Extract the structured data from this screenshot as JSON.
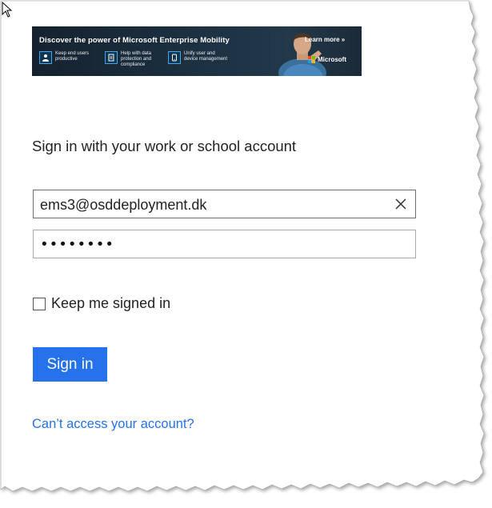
{
  "banner": {
    "title": "Discover the power of Microsoft Enterprise Mobility",
    "features": [
      {
        "icon": "user-icon",
        "text": "Keep end users\nproductive"
      },
      {
        "icon": "document-icon",
        "text": "Help with data\nprotection and\ncompliance"
      },
      {
        "icon": "device-icon",
        "text": "Unify user and\ndevice management"
      }
    ],
    "learn_more": "Learn more »",
    "brand": "Microsoft",
    "brand_colors": [
      "#f25022",
      "#7fba00",
      "#00a4ef",
      "#ffb900"
    ]
  },
  "heading": "Sign in with your work or school account",
  "email": {
    "value": "ems3@osddeployment.dk",
    "clear_icon": "close-icon"
  },
  "password": {
    "masked_value": "••••••••"
  },
  "keep_signed_in": {
    "label": "Keep me signed in",
    "checked": false
  },
  "signin_button": {
    "label": "Sign in",
    "color": "#2672ec"
  },
  "cant_access_link": "Can’t access your account?",
  "colors": {
    "accent": "#2672ec"
  }
}
